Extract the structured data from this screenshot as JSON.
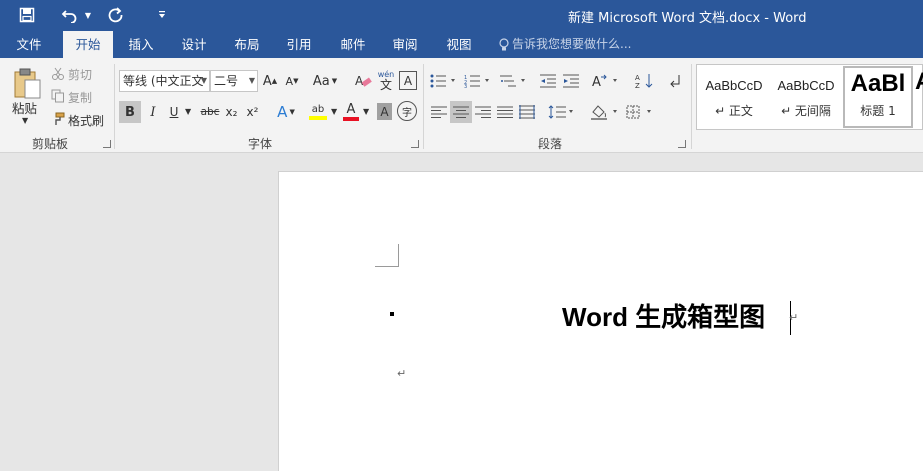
{
  "title_bar": {
    "title": "新建 Microsoft Word 文档.docx - Word",
    "save_icon": "save-icon",
    "undo_icon": "undo-icon",
    "redo_icon": "redo-icon",
    "customize_icon": "customize-qat-icon"
  },
  "tabs": [
    {
      "label": "文件"
    },
    {
      "label": "开始",
      "active": true
    },
    {
      "label": "插入"
    },
    {
      "label": "设计"
    },
    {
      "label": "布局"
    },
    {
      "label": "引用"
    },
    {
      "label": "邮件"
    },
    {
      "label": "审阅"
    },
    {
      "label": "视图"
    }
  ],
  "tell_me": "告诉我您想要做什么...",
  "clipboard": {
    "paste": "粘贴",
    "cut": "剪切",
    "copy": "复制",
    "format_painter": "格式刷",
    "group_label": "剪贴板"
  },
  "font": {
    "font_name": "等线 (中文正文",
    "font_size": "二号",
    "grow": "A",
    "shrink": "A",
    "change_case": "Aa",
    "phonetic_top": "wén",
    "phonetic_bottom": "文",
    "char_border": "A",
    "bold": "B",
    "italic": "I",
    "underline": "U",
    "strike": "abc",
    "subscript": "x₂",
    "superscript": "x²",
    "text_effects": "A",
    "highlight": "ab",
    "font_color": "A",
    "char_shading": "A",
    "enclose": "字",
    "group_label": "字体"
  },
  "paragraph": {
    "group_label": "段落"
  },
  "styles": {
    "items": [
      {
        "sample": "AaBbCcD",
        "name": "↵ 正文"
      },
      {
        "sample": "AaBbCcD",
        "name": "↵ 无间隔"
      },
      {
        "sample": "AaBl",
        "name": "标题 1"
      }
    ],
    "more_sample": "A"
  },
  "document": {
    "heading": "Word 生成箱型图",
    "paragraph_mark": "↵",
    "empty_paragraph_mark": "↵"
  },
  "colors": {
    "title_bar": "#2b579a",
    "ribbon": "#f3f3f3",
    "highlight_yellow": "#ffff00",
    "font_color_red": "#e81123",
    "workspace": "#e6e6e6"
  }
}
